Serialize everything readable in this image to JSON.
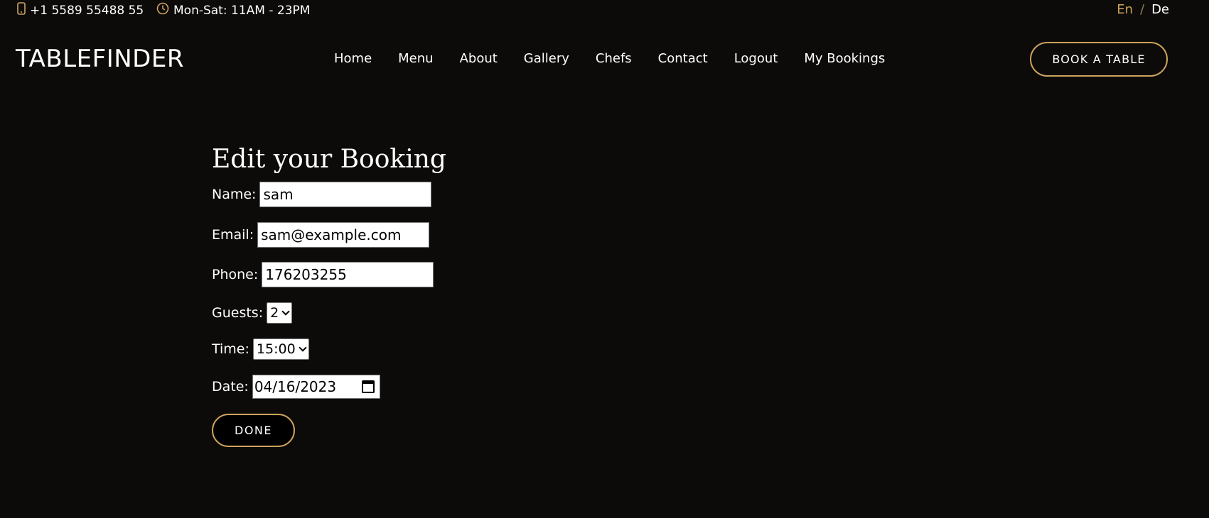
{
  "topbar": {
    "phone_icon": "phone-icon",
    "phone": "+1 5589 55488 55",
    "hours_icon": "clock-icon",
    "hours": "Mon-Sat: 11AM - 23PM",
    "lang_en": "En",
    "lang_sep": "/",
    "lang_de": "De"
  },
  "header": {
    "logo": "TABLEFINDER",
    "nav": [
      "Home",
      "Menu",
      "About",
      "Gallery",
      "Chefs",
      "Contact",
      "Logout",
      "My Bookings"
    ],
    "book_button": "BOOK A TABLE"
  },
  "form": {
    "title": "Edit your Booking",
    "name_label": "Name:",
    "name_value": "sam",
    "email_label": "Email:",
    "email_value": "sam@example.com",
    "phone_label": "Phone:",
    "phone_value": "176203255",
    "guests_label": "Guests:",
    "guests_value": "2",
    "time_label": "Time:",
    "time_value": "15:00",
    "date_label": "Date:",
    "date_value": "04/16/2023",
    "done_button": "DONE"
  },
  "colors": {
    "background": "#0c0b09",
    "accent": "#cda45e",
    "text": "#ffffff"
  }
}
